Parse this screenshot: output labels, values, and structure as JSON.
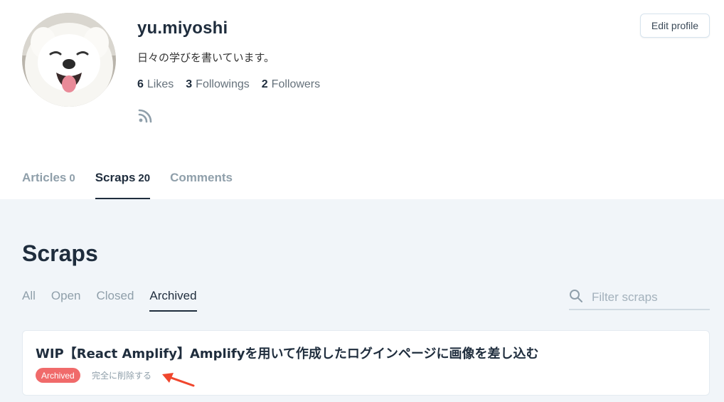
{
  "profile": {
    "username": "yu.miyoshi",
    "bio": "日々の学びを書いています。",
    "likes_count": "6",
    "likes_label": "Likes",
    "followings_count": "3",
    "followings_label": "Followings",
    "followers_count": "2",
    "followers_label": "Followers",
    "edit_label": "Edit profile",
    "avatar_icon": "dog-avatar",
    "rss_icon": "rss-icon"
  },
  "tabs": [
    {
      "label": "Articles",
      "count": "0",
      "active": false
    },
    {
      "label": "Scraps",
      "count": "20",
      "active": true
    },
    {
      "label": "Comments",
      "count": "",
      "active": false
    }
  ],
  "scraps": {
    "title": "Scraps",
    "filters": [
      {
        "label": "All",
        "active": false
      },
      {
        "label": "Open",
        "active": false
      },
      {
        "label": "Closed",
        "active": false
      },
      {
        "label": "Archived",
        "active": true
      }
    ],
    "search": {
      "placeholder": "Filter scraps",
      "value": ""
    },
    "items": [
      {
        "title": "WIP【React Amplify】Amplifyを用いて作成したログインページに画像を差し込む",
        "badge": "Archived",
        "action": "完全に削除する"
      }
    ]
  },
  "colors": {
    "badge": "#f06a6a",
    "annotation_arrow": "#f0462d",
    "background_main": "#f1f5f9"
  }
}
